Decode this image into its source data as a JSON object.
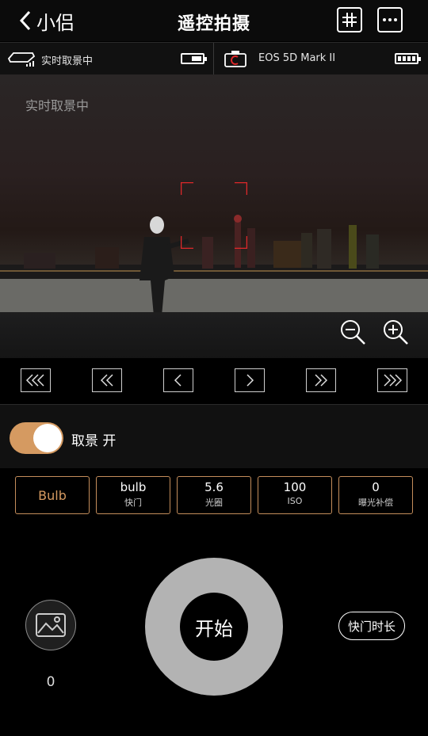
{
  "header": {
    "back_label": "小侣",
    "title": "遥控拍摄"
  },
  "status": {
    "live_label": "实时取景中",
    "camera_model": "EOS 5D Mark II"
  },
  "live_view": {
    "watermark": "实时取景中"
  },
  "toggle": {
    "label": "取景 开",
    "on": true
  },
  "settings": [
    {
      "value": "Bulb",
      "label": ""
    },
    {
      "value": "bulb",
      "label": "快门"
    },
    {
      "value": "5.6",
      "label": "光圈"
    },
    {
      "value": "100",
      "label": "ISO"
    },
    {
      "value": "0",
      "label": "曝光补偿"
    }
  ],
  "bottom": {
    "photo_count": "0",
    "shutter_label": "开始",
    "duration_label": "快门时长"
  },
  "colors": {
    "accent": "#d59a61",
    "focus_frame": "#e0282a"
  },
  "icons": [
    "back-chevron-icon",
    "grid-icon",
    "more-icon",
    "drone-icon",
    "battery-icon",
    "camera-icon",
    "zoom-out-icon",
    "zoom-in-icon",
    "gallery-icon"
  ]
}
